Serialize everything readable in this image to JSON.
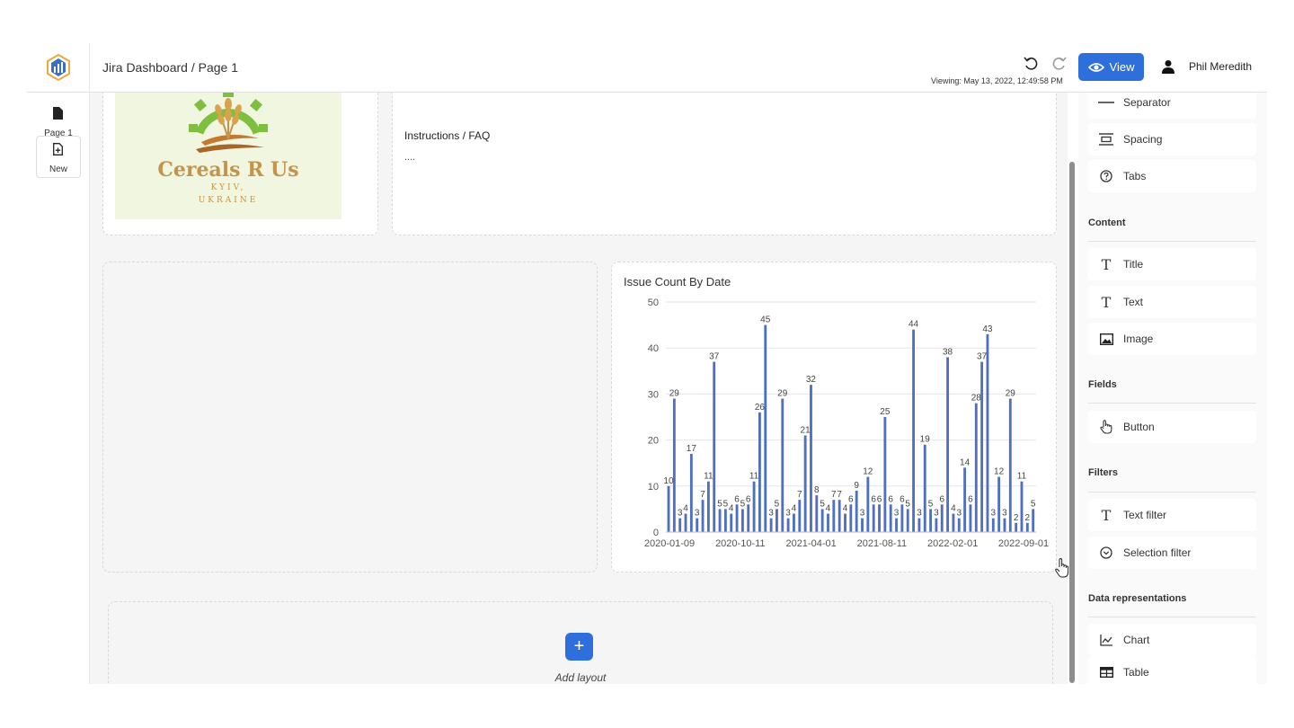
{
  "header": {
    "page_path": "Jira Dashboard / Page 1",
    "view_label": "View",
    "viewing_text": "Viewing: May 13, 2022, 12:49:58 PM",
    "user_name": "Phil Meredith",
    "accent_color": "#2f6fdc"
  },
  "left_nav": {
    "page_label": "Page 1",
    "new_label": "New"
  },
  "logo_card": {
    "brand_name": "Cereals R Us",
    "city": "KYIV,",
    "country": "UKRAINE"
  },
  "faq_card": {
    "title": "Instructions / FAQ",
    "text": "...."
  },
  "chart_data": {
    "type": "bar",
    "title": "Issue Count By Date",
    "xlabel": "",
    "ylabel": "",
    "ylim": [
      0,
      50
    ],
    "yticks": [
      0,
      10,
      20,
      30,
      40,
      50
    ],
    "xtick_labels": [
      "2020-01-09",
      "2020-10-11",
      "2021-04-01",
      "2021-08-11",
      "2022-02-01",
      "2022-09-01"
    ],
    "grid": true,
    "legend": "none",
    "color": "#4f6fc4",
    "labeled_values": [
      10,
      29,
      3,
      4,
      17,
      3,
      7,
      11,
      37,
      5,
      5,
      4,
      6,
      5,
      6,
      11,
      26,
      45,
      3,
      5,
      29,
      3,
      4,
      7,
      21,
      32,
      8,
      5,
      4,
      7,
      7,
      4,
      6,
      9,
      3,
      12,
      6,
      6,
      25,
      6,
      3,
      6,
      5,
      44,
      3,
      19,
      5,
      3,
      6,
      38,
      4,
      3,
      14,
      6,
      28,
      37,
      43,
      3,
      12,
      3,
      29,
      2,
      11,
      2,
      5
    ]
  },
  "add_layout_label": "Add layout",
  "right_panel": {
    "layout_items": [
      {
        "label": "Separator",
        "icon": "separator-icon"
      },
      {
        "label": "Spacing",
        "icon": "spacing-icon"
      },
      {
        "label": "Tabs",
        "icon": "question-circle-icon"
      }
    ],
    "sections": {
      "content": "Content",
      "fields": "Fields",
      "filters": "Filters",
      "data_representations": "Data representations"
    },
    "content_items": [
      {
        "label": "Title",
        "icon": "title-text-icon"
      },
      {
        "label": "Text",
        "icon": "text-icon"
      },
      {
        "label": "Image",
        "icon": "image-icon"
      }
    ],
    "field_items": [
      {
        "label": "Button",
        "icon": "hand-pointer-icon"
      }
    ],
    "filter_items": [
      {
        "label": "Text filter",
        "icon": "text-filter-icon"
      },
      {
        "label": "Selection filter",
        "icon": "chevron-circle-icon"
      }
    ],
    "data_items": [
      {
        "label": "Chart",
        "icon": "area-chart-icon"
      },
      {
        "label": "Table",
        "icon": "table-icon"
      }
    ]
  }
}
